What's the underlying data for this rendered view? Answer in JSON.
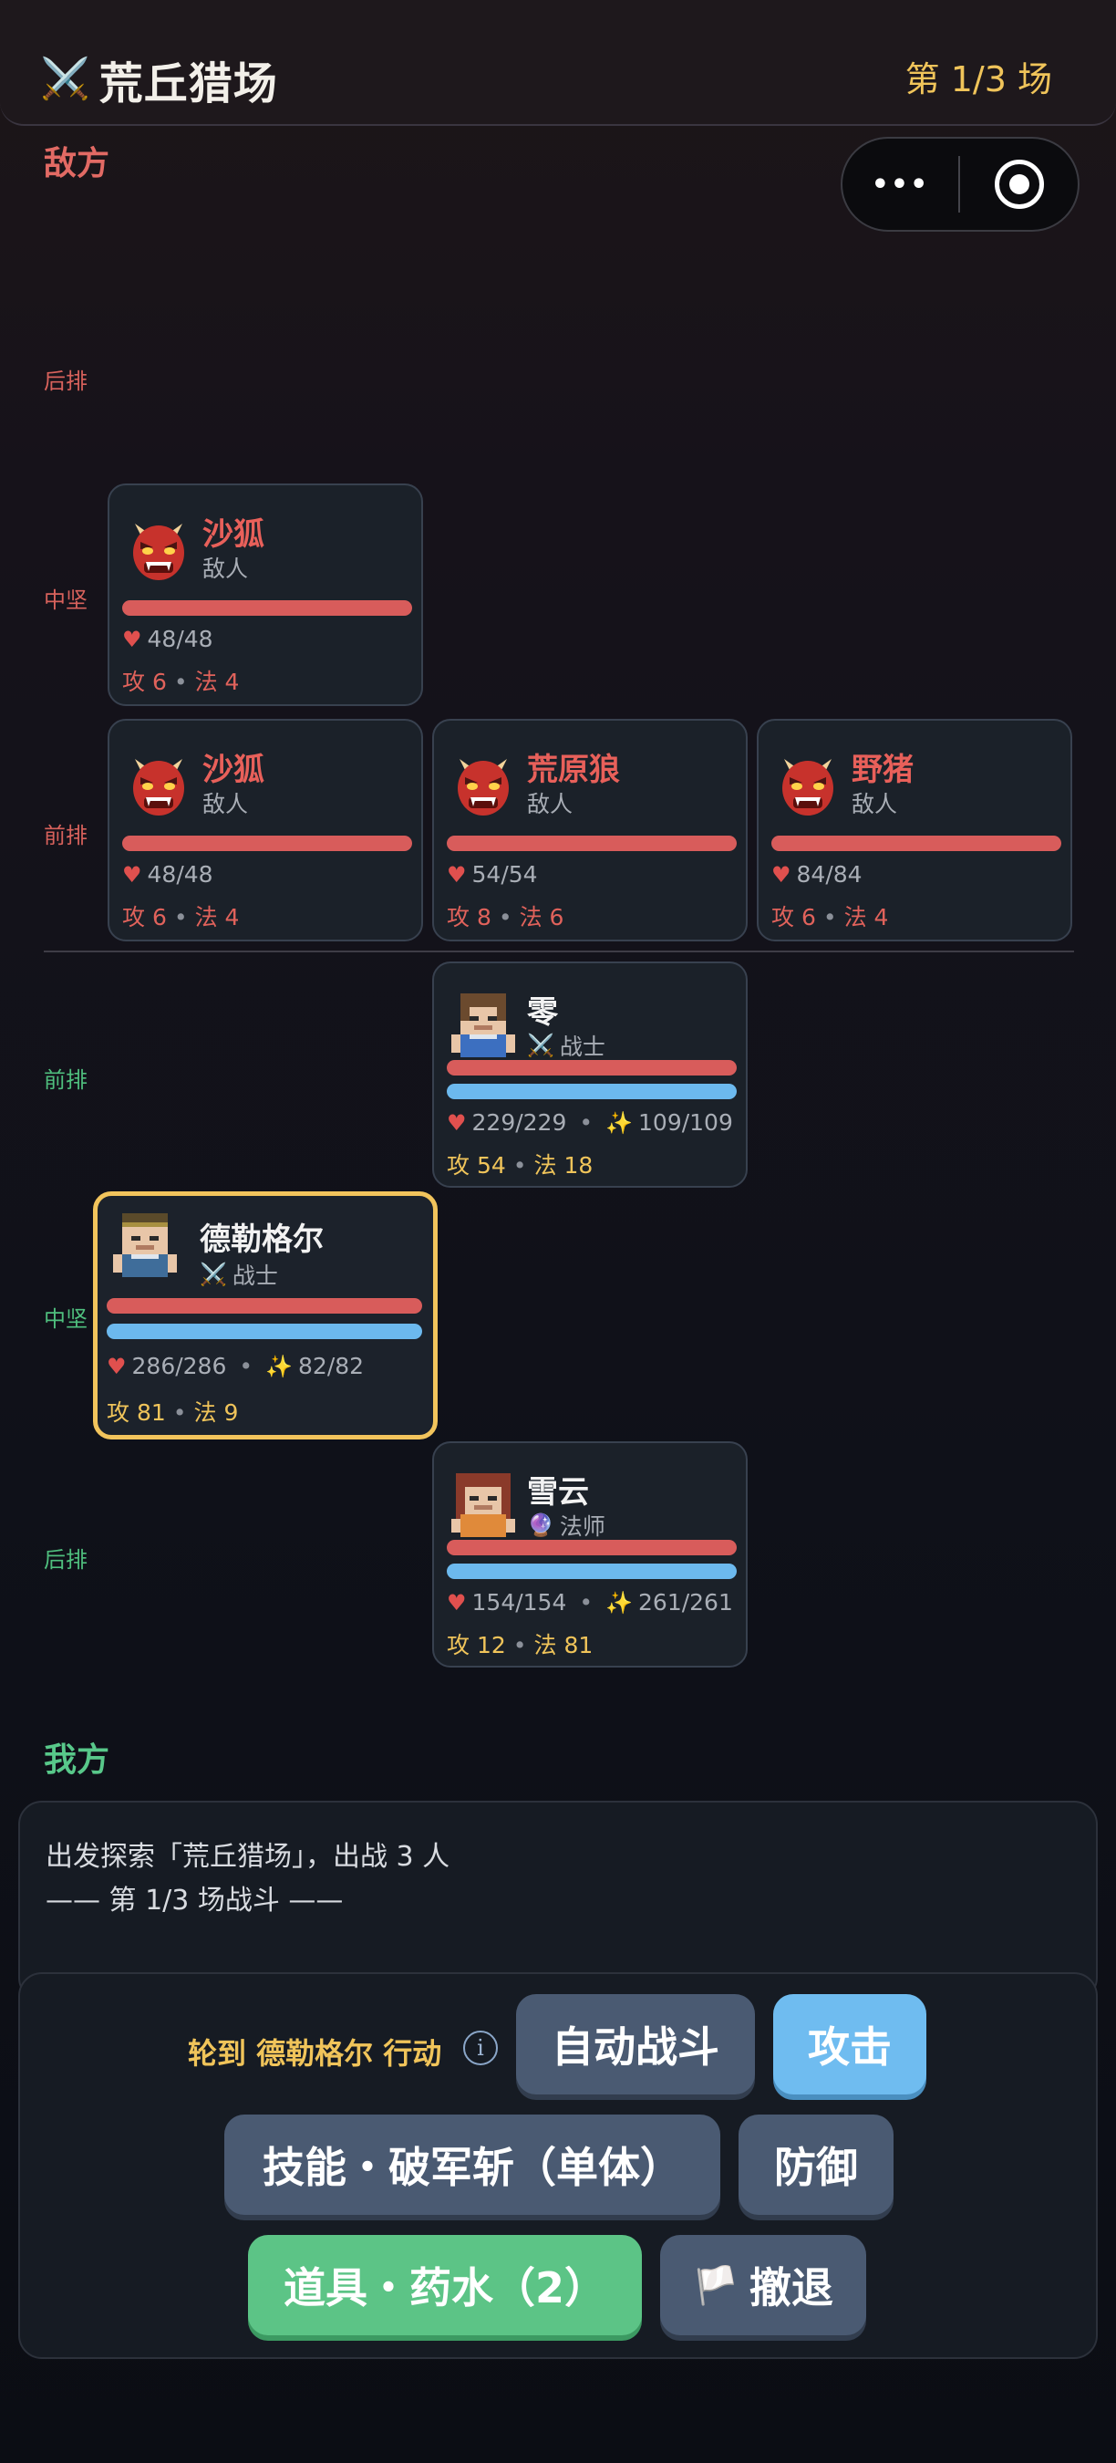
{
  "header": {
    "icon": "crossed-swords-icon",
    "title": "荒丘猎场",
    "battle_counter": "第 1/3 场"
  },
  "capsule": {
    "more_label": "•••"
  },
  "sections": {
    "enemy": "敌方",
    "ally": "我方"
  },
  "row_labels": {
    "back": "后排",
    "middle": "中坚",
    "front": "前排"
  },
  "enemies": [
    {
      "name": "沙狐",
      "role": "敌人",
      "hp": "48/48",
      "hp_fraction": 1.0,
      "atk": "攻 6",
      "mag": "法 4",
      "row": "中坚"
    },
    {
      "name": "沙狐",
      "role": "敌人",
      "hp": "48/48",
      "hp_fraction": 1.0,
      "atk": "攻 6",
      "mag": "法 4",
      "row": "前排"
    },
    {
      "name": "荒原狼",
      "role": "敌人",
      "hp": "54/54",
      "hp_fraction": 1.0,
      "atk": "攻 8",
      "mag": "法 6",
      "row": "前排"
    },
    {
      "name": "野猪",
      "role": "敌人",
      "hp": "84/84",
      "hp_fraction": 1.0,
      "atk": "攻 6",
      "mag": "法 4",
      "row": "前排"
    }
  ],
  "allies": [
    {
      "name": "零",
      "role": "战士",
      "role_icon": "crossed-swords-icon",
      "hp": "229/229",
      "mp": "109/109",
      "hp_fraction": 1.0,
      "mp_fraction": 1.0,
      "atk": "攻 54",
      "mag": "法 18",
      "row": "前排"
    },
    {
      "name": "德勒格尔",
      "role": "战士",
      "role_icon": "crossed-swords-icon",
      "hp": "286/286",
      "mp": "82/82",
      "hp_fraction": 1.0,
      "mp_fraction": 1.0,
      "atk": "攻 81",
      "mag": "法 9",
      "row": "中坚",
      "active": true
    },
    {
      "name": "雪云",
      "role": "法师",
      "role_icon": "crystal-ball-icon",
      "hp": "154/154",
      "mp": "261/261",
      "hp_fraction": 1.0,
      "mp_fraction": 1.0,
      "atk": "攻 12",
      "mag": "法 81",
      "row": "后排"
    }
  ],
  "log": [
    "出发探索「荒丘猎场」，出战 3 人",
    "—— 第 1/3 场战斗 ——"
  ],
  "actions": {
    "turn_text": "轮到 德勒格尔 行动",
    "auto_battle": "自动战斗",
    "attack": "攻击",
    "skill": "技能・破军斩（单体）",
    "defend": "防御",
    "item": "道具・药水（2）",
    "retreat": "撤退"
  },
  "colors": {
    "accent_gold": "#f0c45a",
    "enemy_red": "#e8605a",
    "ally_green": "#58c88a",
    "hp_bar": "#d85c5b",
    "mp_bar": "#6cb9ee",
    "attack_button": "#6fbcf0",
    "item_button": "#5cc486"
  }
}
